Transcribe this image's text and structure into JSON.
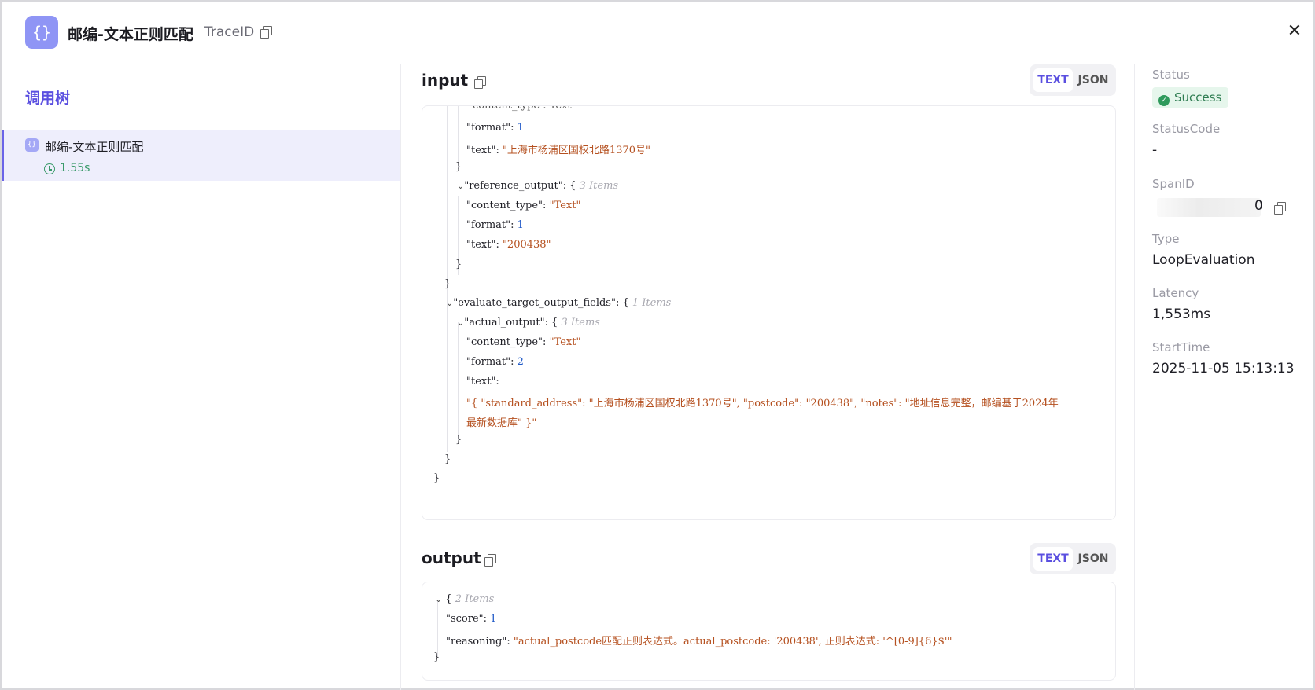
{
  "header": {
    "logo_glyph": "{}",
    "title": "邮编-文本正则匹配",
    "traceid_label": "TraceID",
    "close_glyph": "✕"
  },
  "tree": {
    "title": "调用树",
    "node": {
      "icon_glyph": "{}",
      "label": "邮编-文本正则匹配",
      "duration": "1.55s"
    }
  },
  "input": {
    "label": "input",
    "tabs": {
      "text": "TEXT",
      "json": "JSON"
    },
    "lines": {
      "l1": "content_type : Text",
      "format1_key": "\"format\"",
      "format1_val": "1",
      "text1_key": "\"text\"",
      "text1_val": "\"上海市杨浦区国权北路1370号\"",
      "close1": "}",
      "ref_key": "\"reference_output\"",
      "ref_open": ": {",
      "ref_meta": "3 Items",
      "ct2_key": "\"content_type\"",
      "ct2_val": "\"Text\"",
      "format2_key": "\"format\"",
      "format2_val": "1",
      "text2_key": "\"text\"",
      "text2_val": "\"200438\"",
      "close2": "}",
      "close3": "}",
      "eval_key": "\"evaluate_target_output_fields\"",
      "eval_open": ": {",
      "eval_meta": "1 Items",
      "act_key": "\"actual_output\"",
      "act_open": ": {",
      "act_meta": "3 Items",
      "ct3_key": "\"content_type\"",
      "ct3_val": "\"Text\"",
      "format3_key": "\"format\"",
      "format3_val": "2",
      "text3_key": "\"text\":",
      "text3_val_1": "\"{ \"standard_address\": \"上海市杨浦区国权北路1370号\", \"postcode\": \"200438\", \"notes\": \"地址信息完整，邮编基于2024年",
      "text3_val_2": "最新数据库\" }\"",
      "close4": "}",
      "close5": "}",
      "close6": "}"
    }
  },
  "output": {
    "label": "output",
    "tabs": {
      "text": "TEXT",
      "json": "JSON"
    },
    "lines": {
      "open": "{",
      "meta": "2 Items",
      "score_key": "\"score\"",
      "score_val": "1",
      "reasoning_key": "\"reasoning\"",
      "reasoning_val": "\"actual_postcode匹配正则表达式。actual_postcode: '200438', 正则表达式: '^[0-9]{6}$'\"",
      "close": "}"
    }
  },
  "details": {
    "status_label": "Status",
    "status_value": "Success",
    "statuscode_label": "StatusCode",
    "statuscode_value": "-",
    "spanid_label": "SpanID",
    "spanid_value": "0",
    "type_label": "Type",
    "type_value": "LoopEvaluation",
    "latency_label": "Latency",
    "latency_value": "1,553ms",
    "starttime_label": "StartTime",
    "starttime_value": "2025-11-05 15:13:13"
  },
  "colors": {
    "accent": "#5a4fe0",
    "success": "#2f9a5c",
    "string": "#b5501f",
    "number": "#1f59c7"
  },
  "icons": [
    "braces-icon",
    "copy-icon",
    "close-icon",
    "clock-icon",
    "check-circle-icon",
    "chevron-down-icon"
  ]
}
